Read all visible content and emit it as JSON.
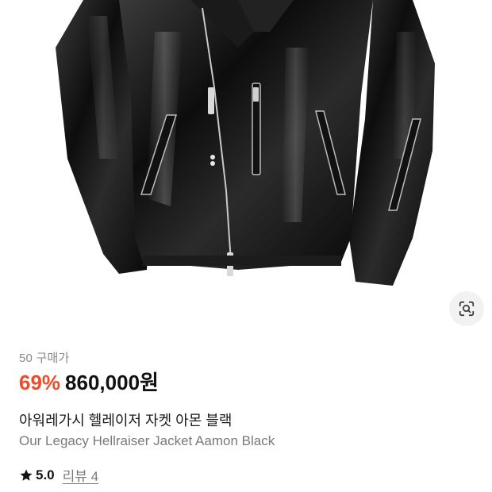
{
  "product": {
    "purchase_count": "50 구매가",
    "discount": "69%",
    "price": "860,000원",
    "title_ko": "아워레가시 헬레이저 자켓 아몬 블랙",
    "title_en": "Our Legacy Hellraiser Jacket Aamon Black",
    "rating": "5.0",
    "review_link": "리뷰 4"
  },
  "icons": {
    "lens": "visual-search-icon",
    "star": "star-icon"
  },
  "colors": {
    "discount": "#ef4b2b",
    "price": "#111111",
    "secondary_text": "#7a7a7a"
  }
}
